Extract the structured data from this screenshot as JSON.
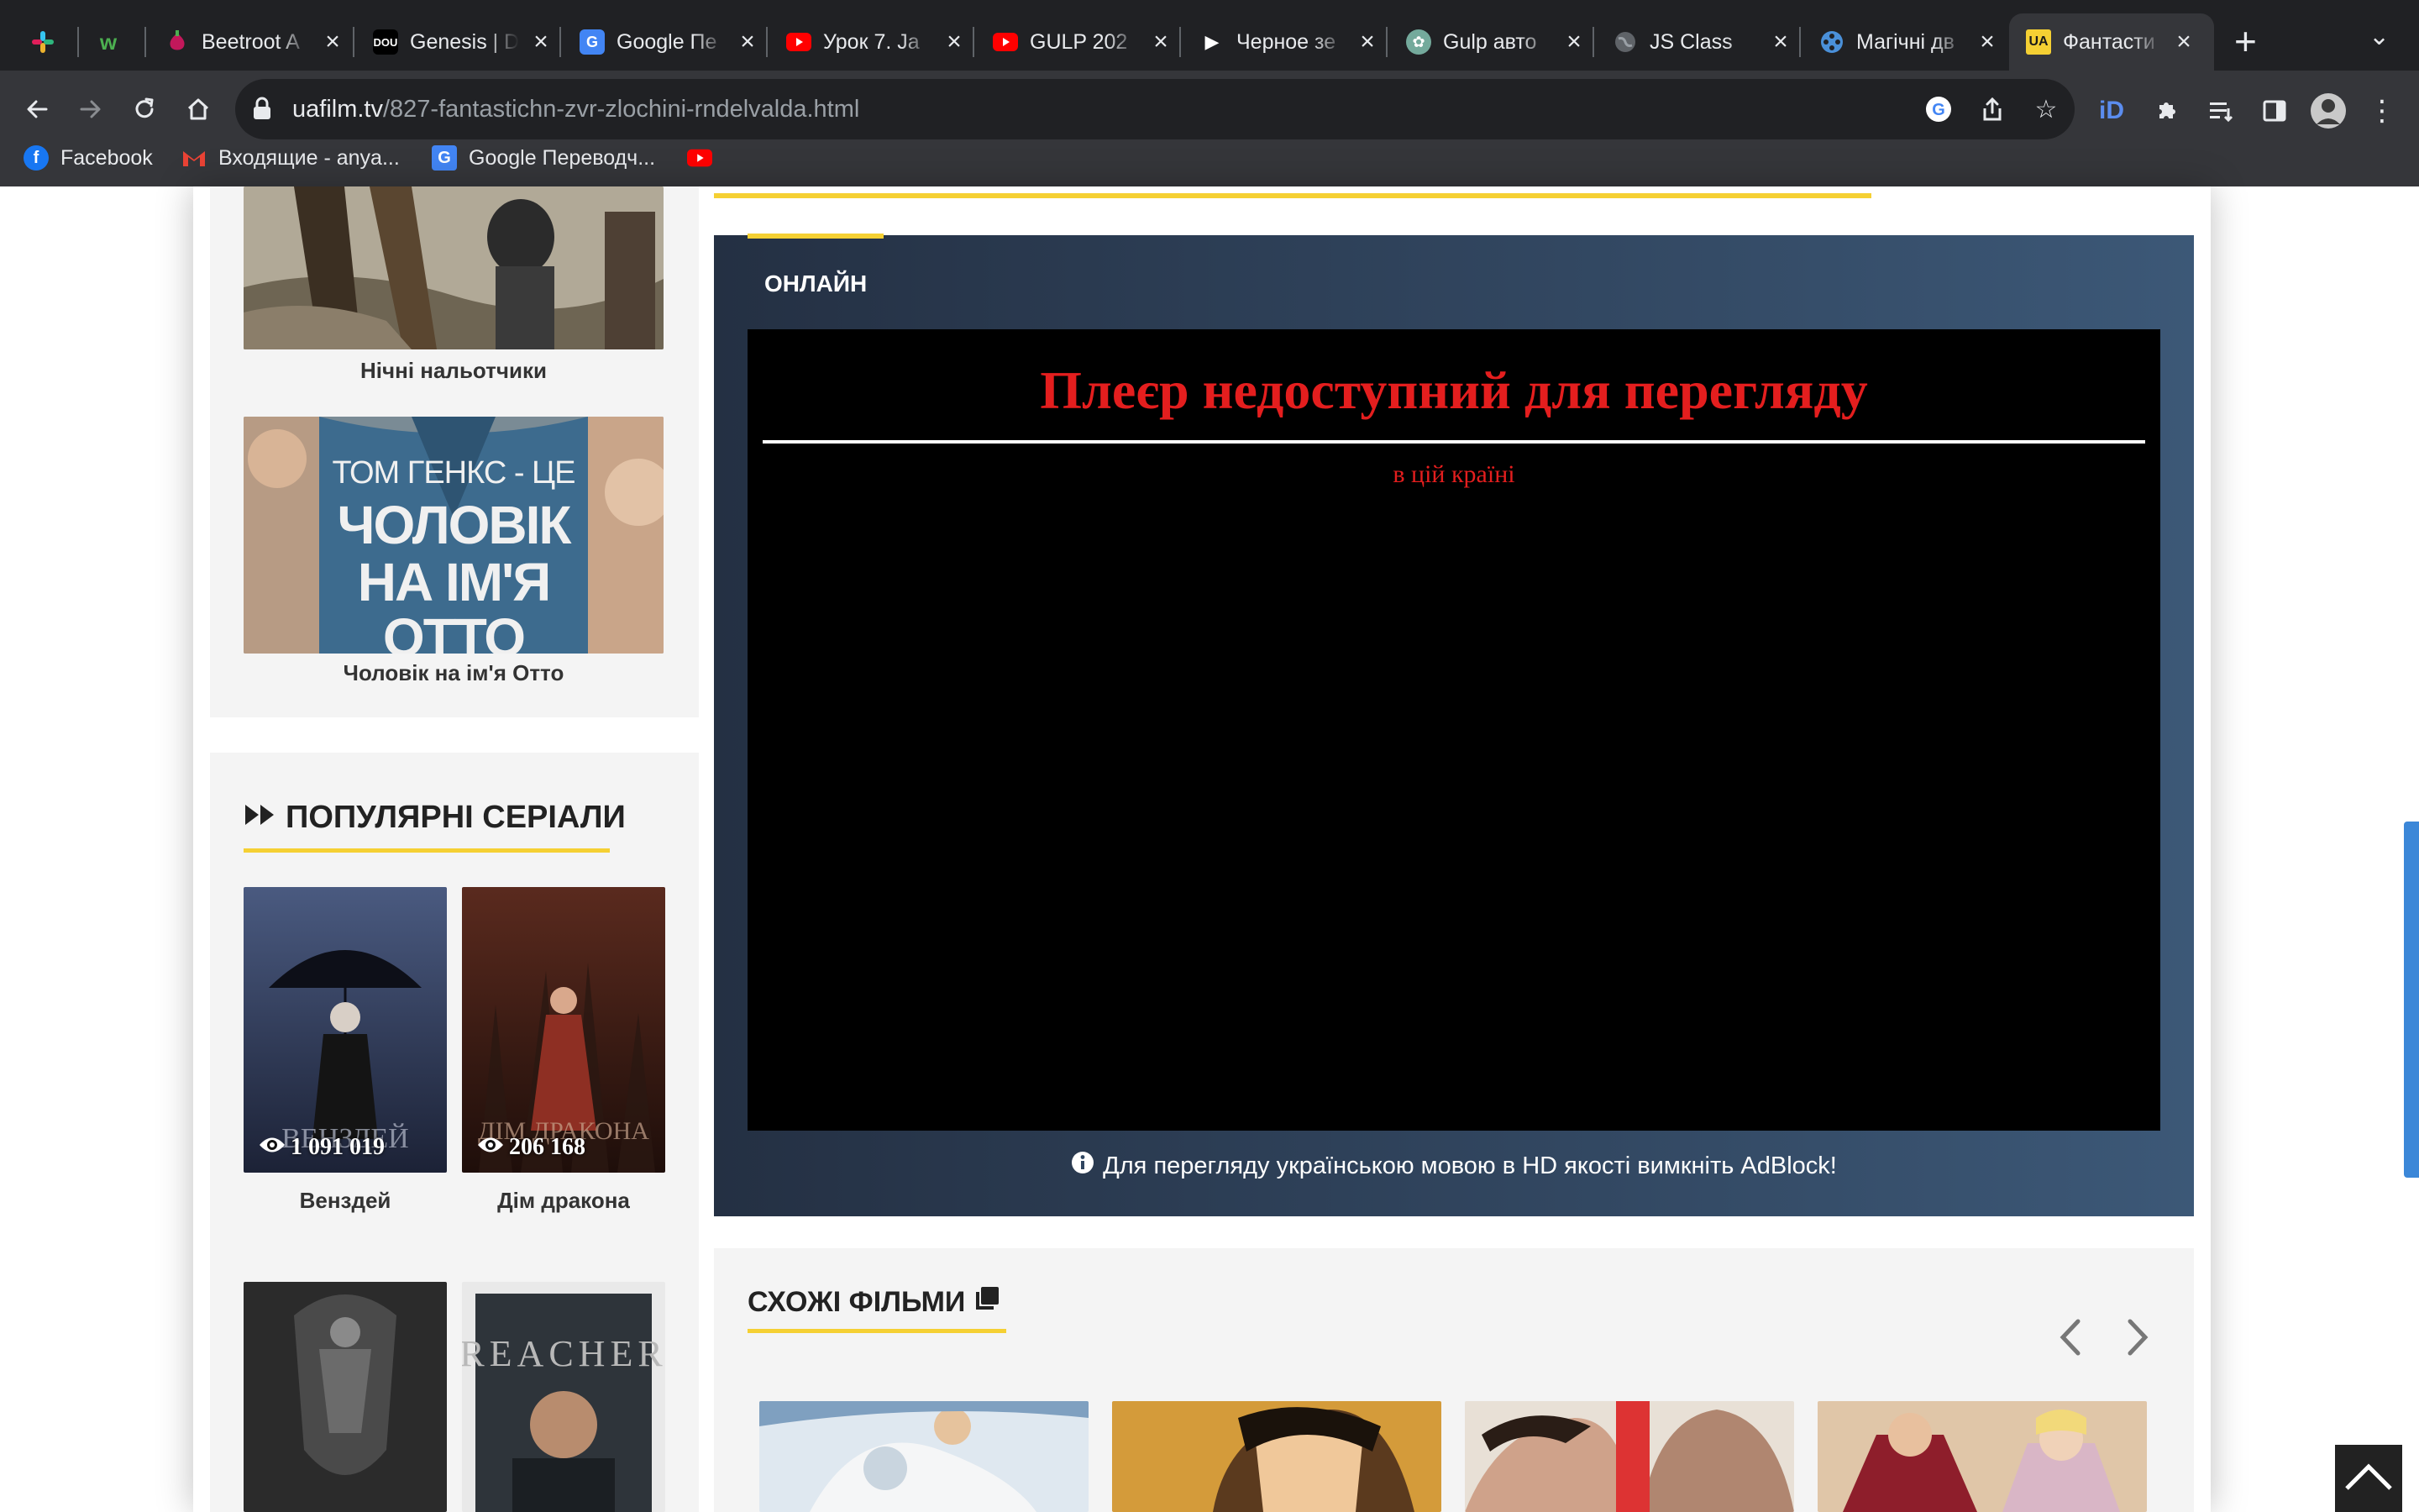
{
  "browser": {
    "tabs": [
      {
        "title": "",
        "icon": "slack-icon"
      },
      {
        "title": "",
        "icon": "w-icon"
      },
      {
        "title": "Beetroot A",
        "icon": "beetroot-icon"
      },
      {
        "title": "Genesis | D",
        "icon": "dou-icon"
      },
      {
        "title": "Google Пе",
        "icon": "google-translate-icon"
      },
      {
        "title": "Урок 7. Ja",
        "icon": "youtube-icon"
      },
      {
        "title": "GULP 202",
        "icon": "youtube-icon"
      },
      {
        "title": "Черное зе",
        "icon": "play-icon"
      },
      {
        "title": "Gulp авто",
        "icon": "chatgpt-icon"
      },
      {
        "title": "JS Class",
        "icon": "globe-icon"
      },
      {
        "title": "Магічні дв",
        "icon": "film-reel-icon"
      },
      {
        "title": "Фантасти",
        "icon": "uafilm-icon"
      }
    ],
    "address": {
      "host": "uafilm.tv",
      "path": "/827-fantastichn-zvr-zlochini-rndelvalda.html"
    },
    "bookmarks": [
      {
        "label": "Facebook",
        "icon": "facebook-icon"
      },
      {
        "label": "Входящие - anya...",
        "icon": "gmail-icon"
      },
      {
        "label": "Google Переводч...",
        "icon": "google-translate-icon"
      },
      {
        "label": "",
        "icon": "youtube-icon"
      }
    ],
    "badge_gmail": "0",
    "fav_dou": "DOU",
    "fav_ua": "UA"
  },
  "sidebar": {
    "top_films": [
      {
        "title": "Нічні нальотчики"
      },
      {
        "title": "Чоловік на ім'я Отто",
        "poster_line1": "ТОМ ГЕНКС - ЦЕ",
        "poster_line2": "ЧОЛОВІК",
        "poster_line3": "НА ІМ'Я",
        "poster_line4": "ОТТО"
      }
    ],
    "popular_series_title": "ПОПУЛЯРНІ СЕРІАЛИ",
    "series": [
      {
        "title": "Венздей",
        "views": "1 091 019",
        "poster_text": "ВЕНЗДЕЙ"
      },
      {
        "title": "Дім дракона",
        "views": "206 168",
        "poster_text": "ДІМ ДРАКОНА"
      },
      {
        "title": "",
        "views": ""
      },
      {
        "title": "",
        "views": "",
        "poster_text": "REACHER"
      }
    ]
  },
  "player": {
    "tab_label": "ОНЛАЙН",
    "unavailable_title": "Плеєр недоступний для перегляду",
    "unavailable_sub": "в цій країні",
    "adblock_note": "Для перегляду українською мовою в HD якості вимкніть AdBlock!"
  },
  "similar": {
    "title": "СХОЖІ ФІЛЬМИ"
  },
  "colors": {
    "accent_yellow": "#f5d033",
    "player_red": "#e41e1e",
    "player_bg_dark": "#243043",
    "player_bg_light": "#3c5877"
  }
}
